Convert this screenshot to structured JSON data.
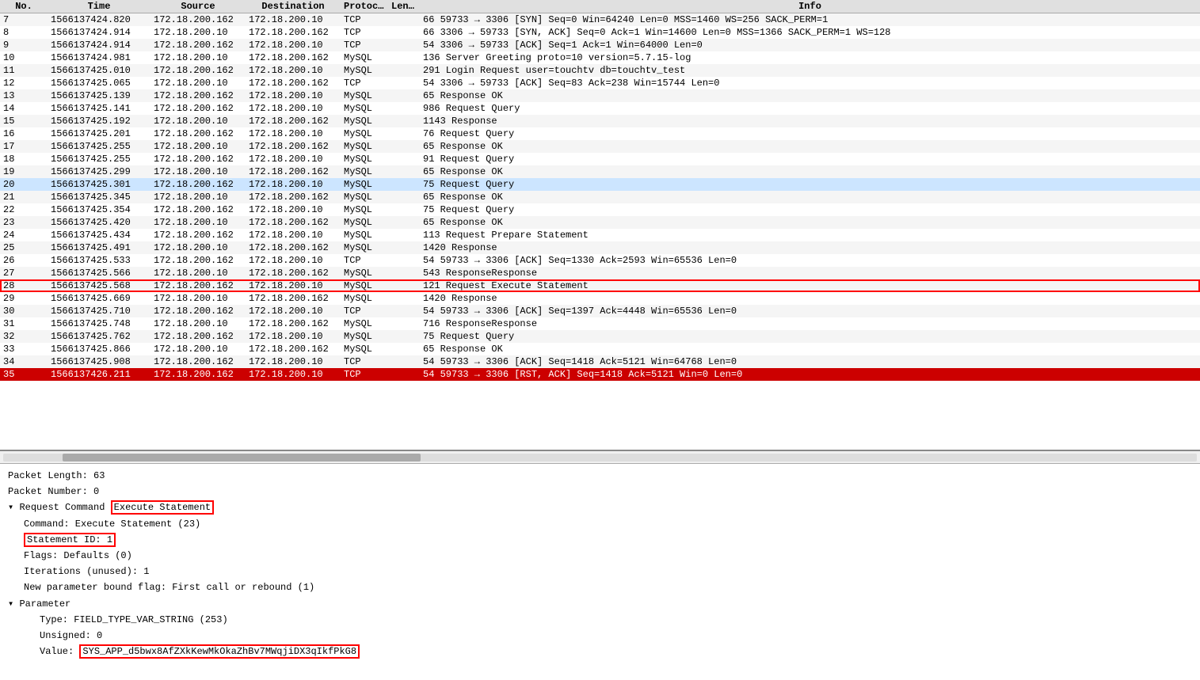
{
  "table": {
    "columns": [
      "No.",
      "Time",
      "Source",
      "Destination",
      "Protocol",
      "Length",
      "Info"
    ],
    "rows": [
      {
        "no": "7",
        "time": "1566137424.820",
        "src": "172.18.200.162",
        "dst": "172.18.200.10",
        "proto": "TCP",
        "len": "",
        "info": "66 59733 → 3306 [SYN] Seq=0 Win=64240 Len=0 MSS=1460 WS=256 SACK_PERM=1",
        "style": "odd"
      },
      {
        "no": "8",
        "time": "1566137424.914",
        "src": "172.18.200.10",
        "dst": "172.18.200.162",
        "proto": "TCP",
        "len": "",
        "info": "66 3306 → 59733 [SYN, ACK] Seq=0 Ack=1 Win=14600 Len=0 MSS=1366 SACK_PERM=1 WS=128",
        "style": "even"
      },
      {
        "no": "9",
        "time": "1566137424.914",
        "src": "172.18.200.162",
        "dst": "172.18.200.10",
        "proto": "TCP",
        "len": "",
        "info": "54 3306 → 59733 [ACK] Seq=1 Ack=1 Win=64000 Len=0",
        "style": "odd"
      },
      {
        "no": "10",
        "time": "1566137424.981",
        "src": "172.18.200.10",
        "dst": "172.18.200.162",
        "proto": "MySQL",
        "len": "",
        "info": "136 Server Greeting proto=10 version=5.7.15-log",
        "style": "even"
      },
      {
        "no": "11",
        "time": "1566137425.010",
        "src": "172.18.200.162",
        "dst": "172.18.200.10",
        "proto": "MySQL",
        "len": "",
        "info": "291 Login Request user=touchtv db=touchtv_test",
        "style": "odd"
      },
      {
        "no": "12",
        "time": "1566137425.065",
        "src": "172.18.200.10",
        "dst": "172.18.200.162",
        "proto": "TCP",
        "len": "",
        "info": "54 3306 → 59733 [ACK] Seq=83 Ack=238 Win=15744 Len=0",
        "style": "even"
      },
      {
        "no": "13",
        "time": "1566137425.139",
        "src": "172.18.200.162",
        "dst": "172.18.200.10",
        "proto": "MySQL",
        "len": "",
        "info": "65 Response OK",
        "style": "odd"
      },
      {
        "no": "14",
        "time": "1566137425.141",
        "src": "172.18.200.162",
        "dst": "172.18.200.10",
        "proto": "MySQL",
        "len": "",
        "info": "986 Request Query",
        "style": "even"
      },
      {
        "no": "15",
        "time": "1566137425.192",
        "src": "172.18.200.10",
        "dst": "172.18.200.162",
        "proto": "MySQL",
        "len": "",
        "info": "1143 Response",
        "style": "odd"
      },
      {
        "no": "16",
        "time": "1566137425.201",
        "src": "172.18.200.162",
        "dst": "172.18.200.10",
        "proto": "MySQL",
        "len": "",
        "info": "76 Request Query",
        "style": "even"
      },
      {
        "no": "17",
        "time": "1566137425.255",
        "src": "172.18.200.10",
        "dst": "172.18.200.162",
        "proto": "MySQL",
        "len": "",
        "info": "65 Response OK",
        "style": "odd"
      },
      {
        "no": "18",
        "time": "1566137425.255",
        "src": "172.18.200.162",
        "dst": "172.18.200.10",
        "proto": "MySQL",
        "len": "",
        "info": "91 Request Query",
        "style": "even"
      },
      {
        "no": "19",
        "time": "1566137425.299",
        "src": "172.18.200.10",
        "dst": "172.18.200.162",
        "proto": "MySQL",
        "len": "",
        "info": "65 Response OK",
        "style": "odd"
      },
      {
        "no": "20",
        "time": "1566137425.301",
        "src": "172.18.200.162",
        "dst": "172.18.200.10",
        "proto": "MySQL",
        "len": "",
        "info": "75 Request Query",
        "style": "highlighted"
      },
      {
        "no": "21",
        "time": "1566137425.345",
        "src": "172.18.200.10",
        "dst": "172.18.200.162",
        "proto": "MySQL",
        "len": "",
        "info": "65 Response OK",
        "style": "odd"
      },
      {
        "no": "22",
        "time": "1566137425.354",
        "src": "172.18.200.162",
        "dst": "172.18.200.10",
        "proto": "MySQL",
        "len": "",
        "info": "75 Request Query",
        "style": "even"
      },
      {
        "no": "23",
        "time": "1566137425.420",
        "src": "172.18.200.10",
        "dst": "172.18.200.162",
        "proto": "MySQL",
        "len": "",
        "info": "65 Response OK",
        "style": "odd"
      },
      {
        "no": "24",
        "time": "1566137425.434",
        "src": "172.18.200.162",
        "dst": "172.18.200.10",
        "proto": "MySQL",
        "len": "",
        "info": "113 Request Prepare Statement",
        "style": "even"
      },
      {
        "no": "25",
        "time": "1566137425.491",
        "src": "172.18.200.10",
        "dst": "172.18.200.162",
        "proto": "MySQL",
        "len": "",
        "info": "1420 Response",
        "style": "odd"
      },
      {
        "no": "26",
        "time": "1566137425.533",
        "src": "172.18.200.162",
        "dst": "172.18.200.10",
        "proto": "TCP",
        "len": "",
        "info": "54 59733 → 3306 [ACK] Seq=1330 Ack=2593 Win=65536 Len=0",
        "style": "even"
      },
      {
        "no": "27",
        "time": "1566137425.566",
        "src": "172.18.200.10",
        "dst": "172.18.200.162",
        "proto": "MySQL",
        "len": "",
        "info": "543 ResponseResponse",
        "style": "odd"
      },
      {
        "no": "28",
        "time": "1566137425.568",
        "src": "172.18.200.162",
        "dst": "172.18.200.10",
        "proto": "MySQL",
        "len": "",
        "info": "121 Request Execute Statement",
        "style": "outlined"
      },
      {
        "no": "29",
        "time": "1566137425.669",
        "src": "172.18.200.10",
        "dst": "172.18.200.162",
        "proto": "MySQL",
        "len": "",
        "info": "1420 Response",
        "style": "even"
      },
      {
        "no": "30",
        "time": "1566137425.710",
        "src": "172.18.200.162",
        "dst": "172.18.200.10",
        "proto": "TCP",
        "len": "",
        "info": "54 59733 → 3306 [ACK] Seq=1397 Ack=4448 Win=65536 Len=0",
        "style": "odd"
      },
      {
        "no": "31",
        "time": "1566137425.748",
        "src": "172.18.200.10",
        "dst": "172.18.200.162",
        "proto": "MySQL",
        "len": "",
        "info": "716 ResponseResponse",
        "style": "even"
      },
      {
        "no": "32",
        "time": "1566137425.762",
        "src": "172.18.200.162",
        "dst": "172.18.200.10",
        "proto": "MySQL",
        "len": "",
        "info": "75 Request Query",
        "style": "odd"
      },
      {
        "no": "33",
        "time": "1566137425.866",
        "src": "172.18.200.10",
        "dst": "172.18.200.162",
        "proto": "MySQL",
        "len": "",
        "info": "65 Response OK",
        "style": "even"
      },
      {
        "no": "34",
        "time": "1566137425.908",
        "src": "172.18.200.162",
        "dst": "172.18.200.10",
        "proto": "TCP",
        "len": "",
        "info": "54 59733 → 3306 [ACK] Seq=1418 Ack=5121 Win=64768 Len=0",
        "style": "odd"
      },
      {
        "no": "35",
        "time": "1566137426.211",
        "src": "172.18.200.162",
        "dst": "172.18.200.10",
        "proto": "TCP",
        "len": "",
        "info": "54 59733 → 3306 [RST, ACK] Seq=1418 Ack=5121 Win=0 Len=0",
        "style": "red"
      }
    ]
  },
  "detail": {
    "packet_length_label": "Packet Length: 63",
    "packet_number_label": "Packet Number: 0",
    "request_command_label": "Request Command",
    "request_command_value": "Execute Statement",
    "command_label": "Command: Execute Statement (23)",
    "statement_id_label": "Statement ID: 1",
    "flags_label": "Flags: Defaults (0)",
    "iterations_label": "Iterations (unused): 1",
    "new_param_label": "New parameter bound flag: First call or rebound (1)",
    "parameter_label": "Parameter",
    "type_label": "Type: FIELD_TYPE_VAR_STRING (253)",
    "unsigned_label": "Unsigned: 0",
    "value_label": "Value:",
    "value_content": "SYS_APP_d5bwx8AfZXkKewMkOkaZhBv7MWqjiDX3qIkfPkG8"
  }
}
